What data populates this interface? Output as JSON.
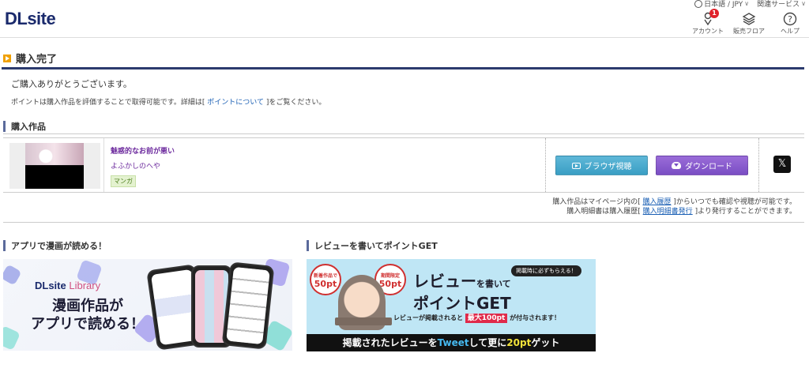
{
  "header": {
    "logo": "DLsite",
    "language": "日本語 / JPY",
    "related_services": "関連サービス",
    "account_label": "アカウント",
    "account_badge": "1",
    "sales_floor_label": "販売フロア",
    "help_label": "ヘルプ"
  },
  "page": {
    "title": "購入完了",
    "thanks": "ご購入ありがとうございます。",
    "point_note_pre": "ポイントは購入作品を評価することで取得可能です。詳細は[",
    "point_note_link": "ポイントについて",
    "point_note_post": "]をご覧ください。"
  },
  "purchased": {
    "heading": "購入作品",
    "works": [
      {
        "title": "魅惑的なお前が悪い",
        "maker": "よふかしのへや",
        "category": "マンガ",
        "browser_button": "ブラウザ視聴",
        "download_button": "ダウンロード",
        "share": "𝕏"
      }
    ],
    "history_note_1_pre": "購入作品はマイページ内の[",
    "history_note_1_link": "購入履歴",
    "history_note_1_post": "]からいつでも確認や視聴が可能です。",
    "history_note_2_pre": "購入明細書は購入履歴[",
    "history_note_2_link": "購入明細書発行",
    "history_note_2_post": "]より発行することができます。"
  },
  "promo_app": {
    "heading": "アプリで漫画が読める！",
    "logo_main": "DLsite",
    "logo_sub": "Library",
    "copy_line1": "漫画作品が",
    "copy_line2": "アプリで読める！"
  },
  "promo_review": {
    "heading": "レビューを書いてポイントGET",
    "bubble1_small": "新着作品で",
    "bubble1_big": "50pt",
    "bubble2_small": "期間限定",
    "bubble2_big": "50pt",
    "tag": "掲載時に必ずもらえる！",
    "big_line1": "レビュー",
    "big_line1_small": "を書いて",
    "big_line2": "ポイントGET",
    "sub_pre": "レビューが掲載されると",
    "sub_red": "最大100pt",
    "sub_post": "が付与されます！",
    "foot_pre": "掲載されたレビューを",
    "foot_tweet": "Tweet",
    "foot_mid": "して更に",
    "foot_pt": "20pt",
    "foot_post": "ゲット"
  }
}
